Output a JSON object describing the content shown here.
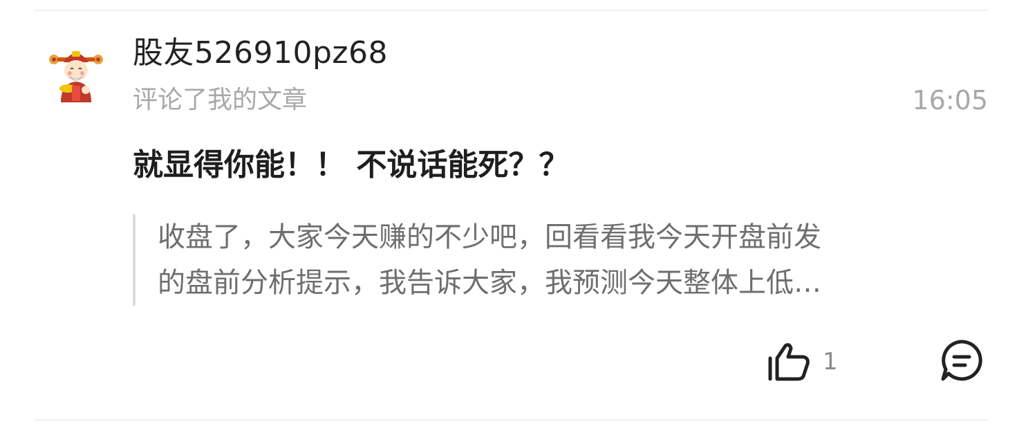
{
  "comment": {
    "username": "股友526910pz68",
    "action": "评论了我的文章",
    "time": "16:05",
    "text": "就显得你能！！ 不说话能死？？",
    "quoted_article": {
      "line1": "收盘了，大家今天赚的不少吧，回看看我今天开盘前发",
      "line2": "的盘前分析提示，我告诉大家，我预测今天整体上低…"
    },
    "like_count": "1"
  },
  "icons": {
    "avatar": "caishen-avatar",
    "like": "thumbs-up-icon",
    "reply": "comment-bubble-icon"
  },
  "colors": {
    "primary_text": "#222222",
    "secondary_text": "#a8a8a8",
    "quote_text": "#6e6e6e",
    "quote_bar": "#dcdcdc"
  }
}
